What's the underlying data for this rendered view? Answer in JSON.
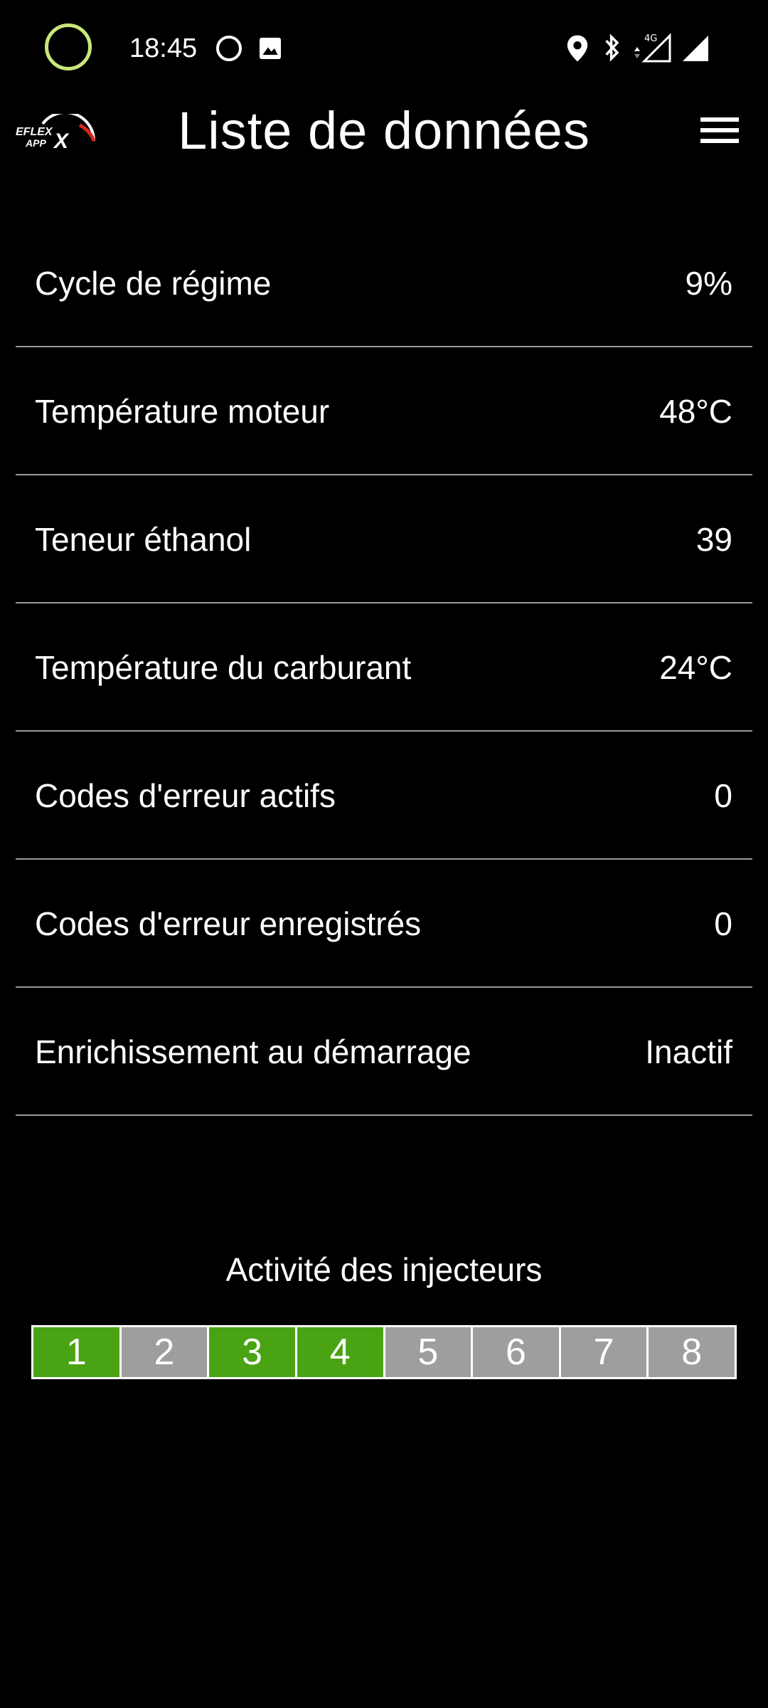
{
  "status_bar": {
    "time": "18:45",
    "network_label": "4G"
  },
  "header": {
    "logo_text": "EFLEX APP X",
    "title": "Liste de données"
  },
  "data_rows": [
    {
      "label": "Cycle de régime",
      "value": "9%"
    },
    {
      "label": "Température moteur",
      "value": "48°C"
    },
    {
      "label": "Teneur éthanol",
      "value": "39"
    },
    {
      "label": "Température du carburant",
      "value": "24°C"
    },
    {
      "label": "Codes d'erreur actifs",
      "value": "0"
    },
    {
      "label": "Codes d'erreur enregistrés",
      "value": "0"
    },
    {
      "label": "Enrichissement au démarrage",
      "value": "Inactif"
    }
  ],
  "injectors": {
    "title": "Activité des injecteurs",
    "items": [
      {
        "label": "1",
        "active": true
      },
      {
        "label": "2",
        "active": false
      },
      {
        "label": "3",
        "active": true
      },
      {
        "label": "4",
        "active": true
      },
      {
        "label": "5",
        "active": false
      },
      {
        "label": "6",
        "active": false
      },
      {
        "label": "7",
        "active": false
      },
      {
        "label": "8",
        "active": false
      }
    ]
  },
  "colors": {
    "background": "#000000",
    "active_injector": "#4aa312",
    "inactive_injector": "#9e9e9e",
    "status_ring": "#c8e87a",
    "logo_accent": "#d8261c"
  },
  "icons": [
    "status-ring-icon",
    "circle-icon",
    "gallery-icon",
    "location-icon",
    "bluetooth-icon",
    "4g-signal-icon",
    "signal-icon",
    "menu-icon"
  ]
}
